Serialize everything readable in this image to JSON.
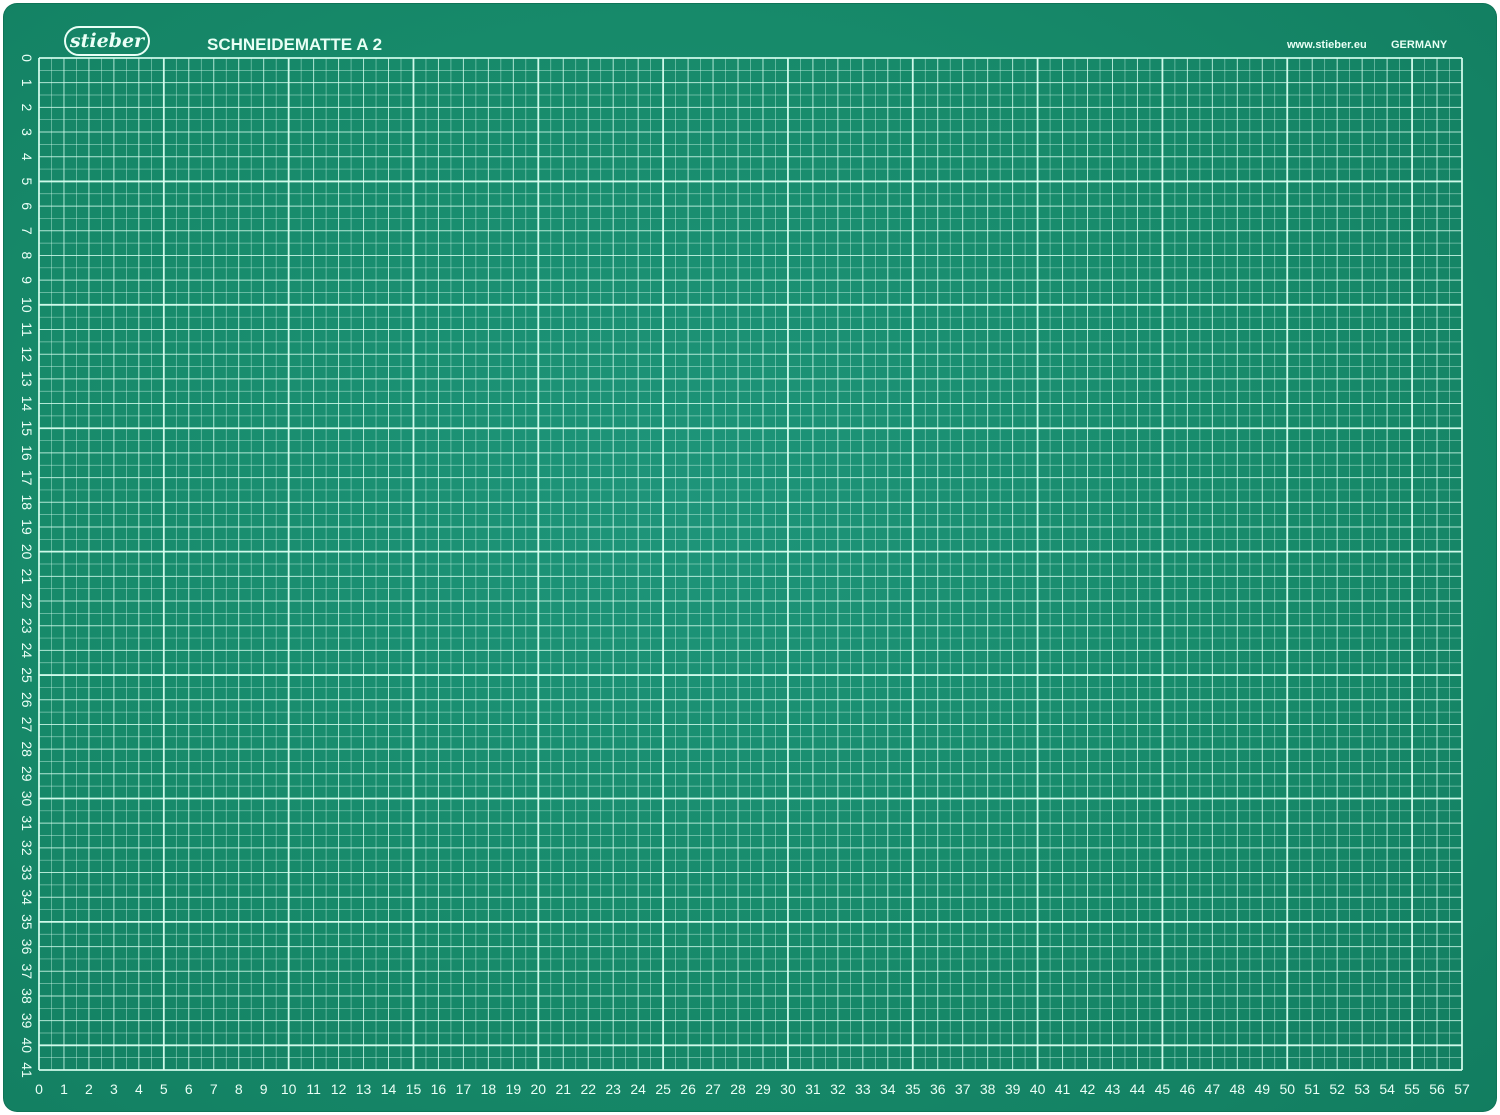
{
  "mat": {
    "brand": "stieber",
    "title": "SCHNEIDEMATTE A 2",
    "website": "www.stieber.eu",
    "country": "GERMANY",
    "x_scale": {
      "min": 0,
      "max": 57,
      "major_every": 5
    },
    "y_scale": {
      "min": 0,
      "max": 41,
      "major_every": 5
    },
    "colors": {
      "mat_green": "#1a8c6c",
      "grid_line": "#d8fff0",
      "label": "#eafff6"
    }
  }
}
